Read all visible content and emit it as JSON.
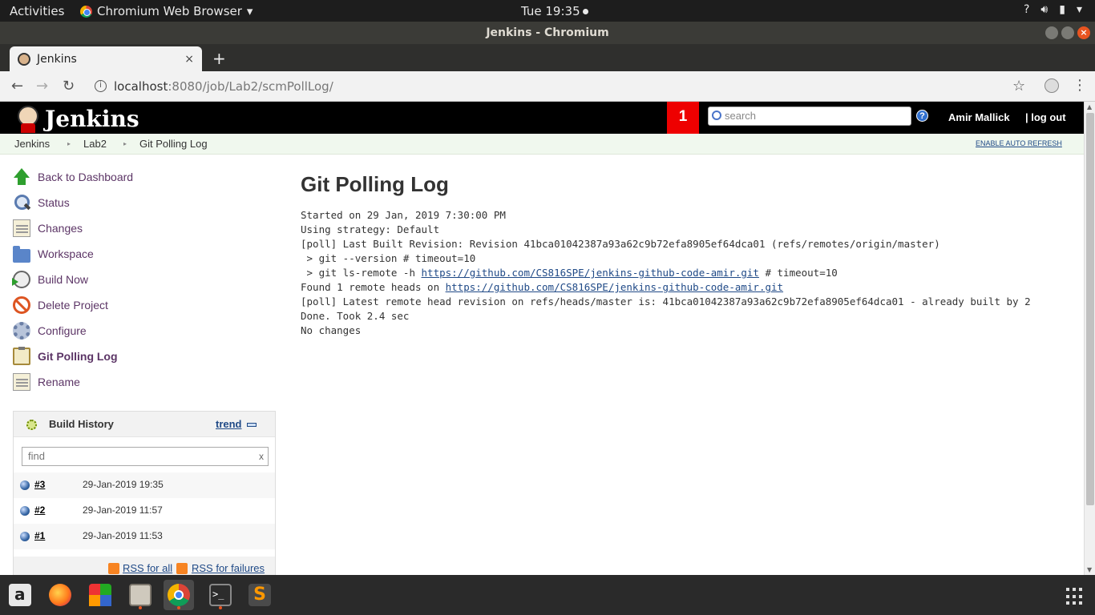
{
  "topbar": {
    "activities": "Activities",
    "app_menu": "Chromium Web Browser",
    "clock": "Tue 19:35",
    "tray_help": "?"
  },
  "window": {
    "title": "Jenkins - Chromium"
  },
  "browser": {
    "tab_title": "Jenkins",
    "tab_close": "×",
    "new_tab": "+",
    "url_host": "localhost",
    "url_path": ":8080/job/Lab2/scmPollLog/"
  },
  "jenkins": {
    "logo_text": "Jenkins",
    "notification_count": "1",
    "search_placeholder": "search",
    "help": "?",
    "user": "Amir Mallick",
    "logout": "| log out",
    "breadcrumbs": [
      "Jenkins",
      "Lab2",
      "Git Polling Log"
    ],
    "auto_refresh": "ENABLE AUTO REFRESH",
    "tasks": [
      {
        "label": "Back to Dashboard",
        "icon": "up-arrow-icon"
      },
      {
        "label": "Status",
        "icon": "magnifier-icon"
      },
      {
        "label": "Changes",
        "icon": "notepad-icon"
      },
      {
        "label": "Workspace",
        "icon": "folder-icon"
      },
      {
        "label": "Build Now",
        "icon": "clock-run-icon"
      },
      {
        "label": "Delete Project",
        "icon": "no-entry-icon"
      },
      {
        "label": "Configure",
        "icon": "gear-icon"
      },
      {
        "label": "Git Polling Log",
        "icon": "clipboard-icon",
        "active": true
      },
      {
        "label": "Rename",
        "icon": "notepad-icon"
      }
    ],
    "build_history": {
      "title": "Build History",
      "trend": "trend",
      "find_placeholder": "find",
      "find_clear": "x",
      "builds": [
        {
          "number": "#3",
          "date": "29-Jan-2019 19:35"
        },
        {
          "number": "#2",
          "date": "29-Jan-2019 11:57"
        },
        {
          "number": "#1",
          "date": "29-Jan-2019 11:53"
        }
      ],
      "rss_all": "RSS for all",
      "rss_failures": "RSS for failures"
    },
    "main": {
      "heading": "Git Polling Log",
      "log": {
        "line1": "Started on 29 Jan, 2019 7:30:00 PM",
        "line2": "Using strategy: Default",
        "line3": "[poll] Last Built Revision: Revision 41bca01042387a93a62c9b72efa8905ef64dca01 (refs/remotes/origin/master)",
        "line4": " > git --version # timeout=10",
        "line5_pre": " > git ls-remote -h ",
        "line5_link": "https://github.com/CS816SPE/jenkins-github-code-amir.git",
        "line5_post": " # timeout=10",
        "line6_pre": "Found 1 remote heads on ",
        "line6_link": "https://github.com/CS816SPE/jenkins-github-code-amir.git",
        "line7": "[poll] Latest remote head revision on refs/heads/master is: 41bca01042387a93a62c9b72efa8905ef64dca01 - already built by 2",
        "line8": "Done. Took 2.4 sec",
        "line9": "No changes"
      }
    }
  },
  "dock": [
    "amazon-icon",
    "firefox-icon",
    "libreoffice-icon",
    "files-icon",
    "chromium-icon",
    "terminal-icon",
    "sublime-icon",
    "app-grid-icon"
  ]
}
